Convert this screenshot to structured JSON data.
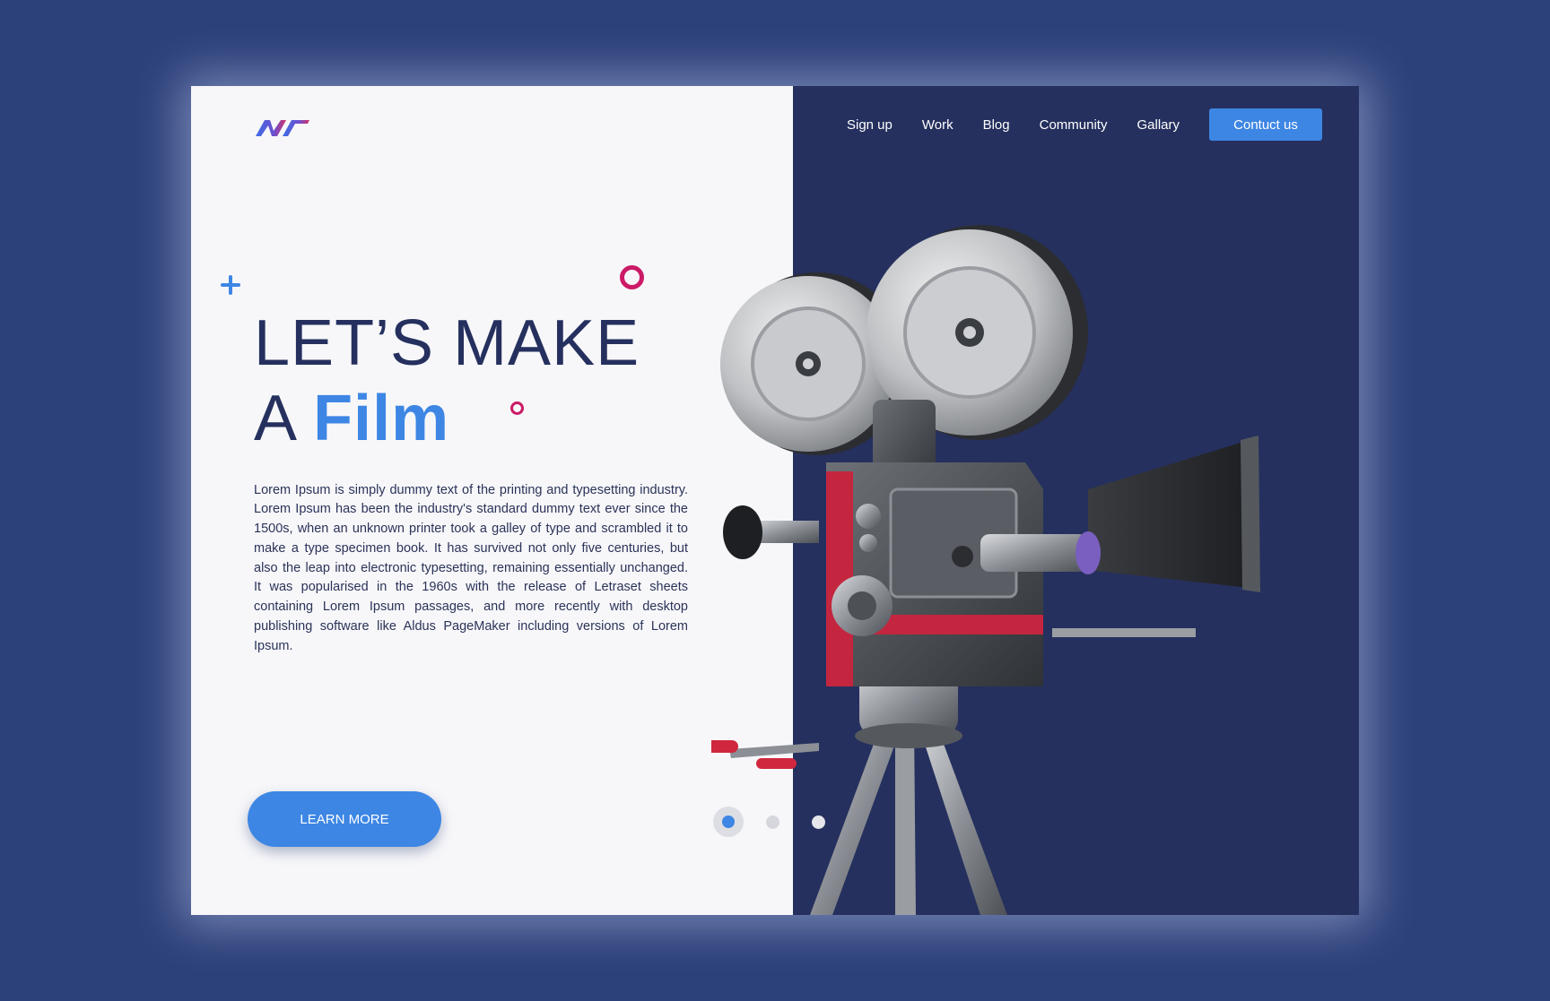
{
  "brand": {
    "logo_icon": "brand-logo-icon",
    "accent": "#3d86e4",
    "navy": "#25305e",
    "magenta": "#cc1a66"
  },
  "nav": {
    "items": [
      "Sign up",
      "Work",
      "Blog",
      "Community",
      "Gallary"
    ],
    "cta": "Contuct us"
  },
  "hero": {
    "line1": "LET’S MAKE",
    "line2_prefix": "A",
    "line2_accent": "Film",
    "body": "Lorem Ipsum is simply dummy text of the printing and typesetting industry. Lorem Ipsum has been the industry's standard dummy text ever since the 1500s, when an unknown printer took a galley of type and scrambled it to make a type specimen book. It has survived not only five centuries, but also the leap into electronic typesetting, remaining essentially unchanged. It was popularised in the 1960s with the release of Letraset sheets containing Lorem Ipsum passages, and more recently with desktop publishing software like Aldus PageMaker including versions of Lorem Ipsum.",
    "cta": "LEARN MORE"
  },
  "carousel": {
    "total": 3,
    "active": 1
  },
  "image": {
    "subject": "vintage-film-camera-icon"
  }
}
